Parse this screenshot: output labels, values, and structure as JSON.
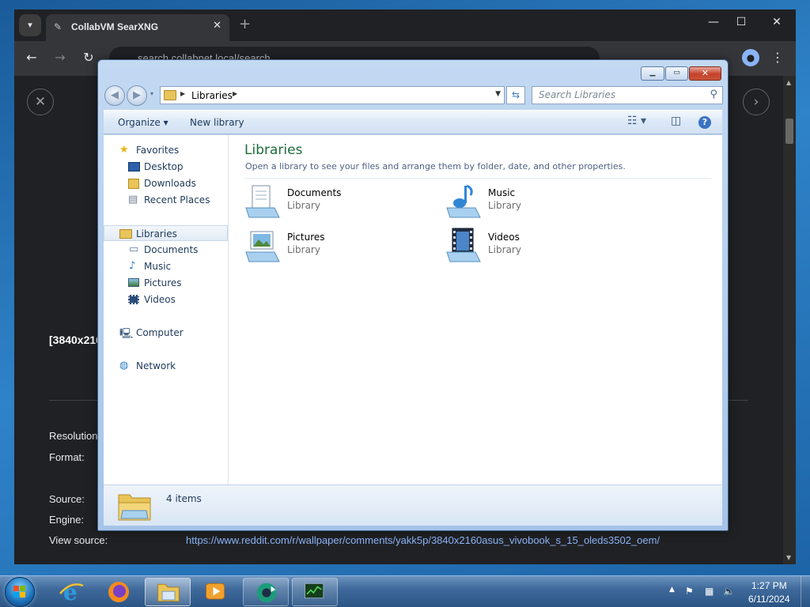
{
  "browser": {
    "tab_title": "CollabVM SearXNG",
    "tab_close": "✕",
    "new_tab": "+",
    "address": "search.collabnet.local/search",
    "win_min": "—",
    "win_max": "☐",
    "win_close": "✕",
    "page": {
      "image_title": "[3840x216",
      "fields": [
        {
          "label": "Resolution"
        },
        {
          "label": "Format:"
        },
        {
          "label": "Source:"
        },
        {
          "label": "Engine:"
        },
        {
          "label": "View source:"
        }
      ],
      "view_source_url": "https://www.reddit.com/r/wallpaper/comments/yakk5p/3840x2160asus_vivobook_s_15_oleds3502_oem/"
    }
  },
  "explorer": {
    "caption": {
      "minimize": "▁",
      "maximize": "▭",
      "close": "✕"
    },
    "address": {
      "crumb": "Libraries"
    },
    "search_placeholder": "Search Libraries",
    "command_bar": {
      "organize": "Organize ▾",
      "new_library": "New library"
    },
    "nav_pane": {
      "favorites": {
        "label": "Favorites",
        "items": [
          "Desktop",
          "Downloads",
          "Recent Places"
        ]
      },
      "libraries": {
        "label": "Libraries",
        "items": [
          "Documents",
          "Music",
          "Pictures",
          "Videos"
        ]
      },
      "computer": "Computer",
      "network": "Network"
    },
    "content": {
      "title": "Libraries",
      "subtitle": "Open a library to see your files and arrange them by folder, date, and other properties.",
      "libraries": [
        {
          "name": "Documents",
          "kind": "Library",
          "icon": "documents-library-icon"
        },
        {
          "name": "Music",
          "kind": "Library",
          "icon": "music-library-icon"
        },
        {
          "name": "Pictures",
          "kind": "Library",
          "icon": "pictures-library-icon"
        },
        {
          "name": "Videos",
          "kind": "Library",
          "icon": "videos-library-icon"
        }
      ]
    },
    "details": {
      "item_count": "4 items"
    }
  },
  "taskbar": {
    "clock_time": "1:27 PM",
    "clock_date": "6/11/2024",
    "apps": [
      "internet-explorer",
      "firefox",
      "windows-explorer",
      "media-player",
      "chrome-like",
      "task-manager"
    ]
  },
  "colors": {
    "library_title": "#1e6b3c",
    "link": "#8ab4f8",
    "taskbar": "#2b5585"
  }
}
